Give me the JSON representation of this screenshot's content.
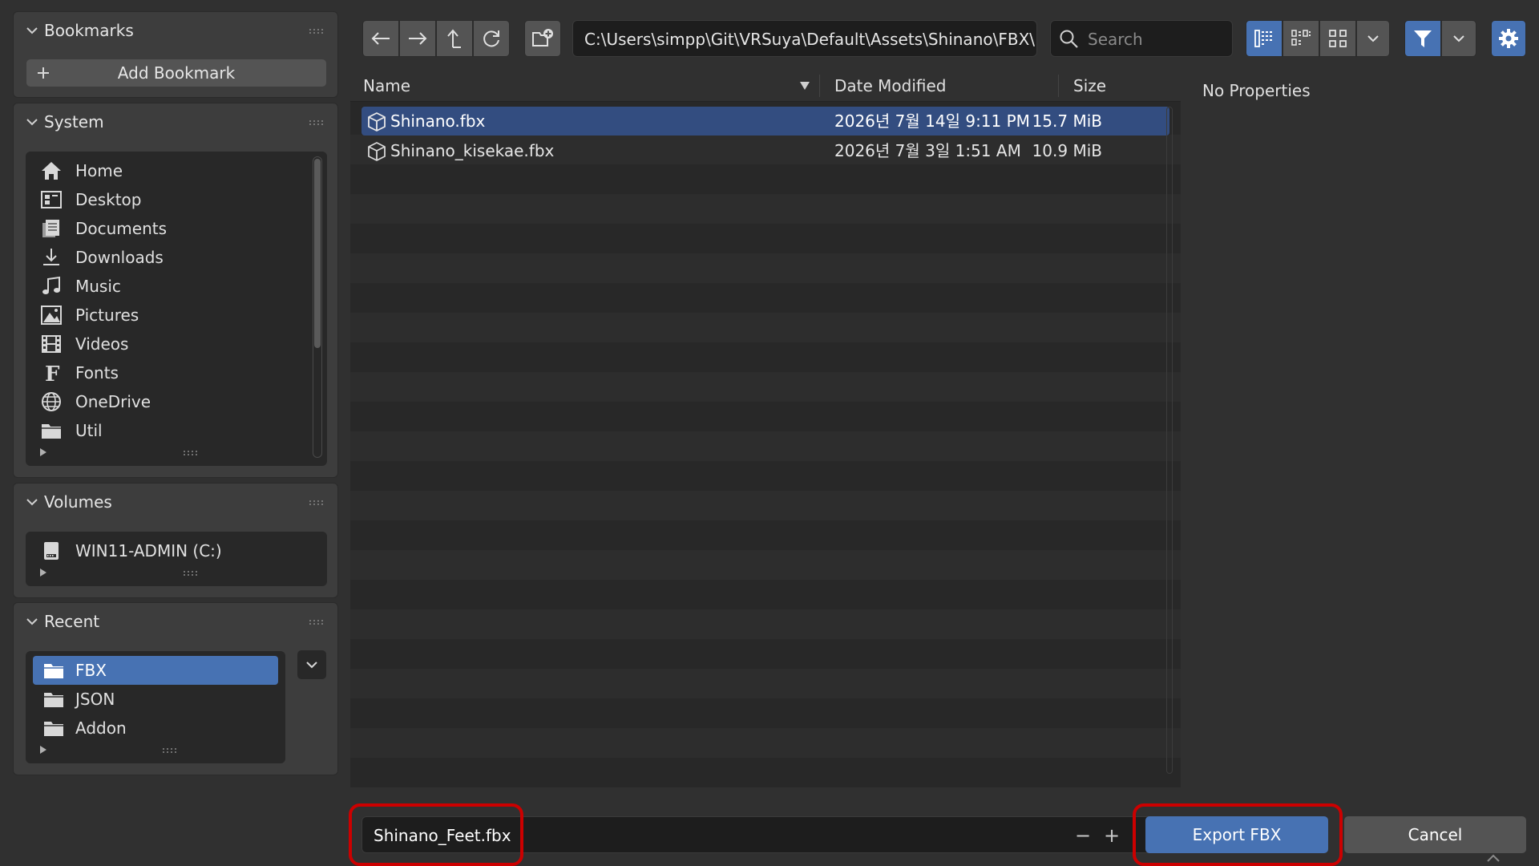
{
  "sidebar": {
    "bookmarks": {
      "title": "Bookmarks",
      "add_label": "Add Bookmark"
    },
    "system": {
      "title": "System",
      "items": [
        {
          "label": "Home",
          "icon": "home-icon"
        },
        {
          "label": "Desktop",
          "icon": "desktop-icon"
        },
        {
          "label": "Documents",
          "icon": "documents-icon"
        },
        {
          "label": "Downloads",
          "icon": "downloads-icon"
        },
        {
          "label": "Music",
          "icon": "music-icon"
        },
        {
          "label": "Pictures",
          "icon": "pictures-icon"
        },
        {
          "label": "Videos",
          "icon": "videos-icon"
        },
        {
          "label": "Fonts",
          "icon": "fonts-icon"
        },
        {
          "label": "OneDrive",
          "icon": "globe-icon"
        },
        {
          "label": "Util",
          "icon": "folder-icon"
        }
      ]
    },
    "volumes": {
      "title": "Volumes",
      "items": [
        {
          "label": "WIN11-ADMIN (C:)",
          "icon": "drive-icon"
        }
      ]
    },
    "recent": {
      "title": "Recent",
      "items": [
        {
          "label": "FBX",
          "icon": "folder-icon",
          "selected": true
        },
        {
          "label": "JSON",
          "icon": "folder-icon"
        },
        {
          "label": "Addon",
          "icon": "folder-icon"
        }
      ]
    }
  },
  "toolbar": {
    "path": "C:\\Users\\simpp\\Git\\VRSuya\\Default\\Assets\\Shinano\\FBX\\",
    "search_placeholder": "Search"
  },
  "file_list": {
    "columns": {
      "name": "Name",
      "date": "Date Modified",
      "size": "Size"
    },
    "files": [
      {
        "name": "Shinano.fbx",
        "date": "2026년 7월 14일 9:11 PM",
        "size": "15.7 MiB",
        "selected": true
      },
      {
        "name": "Shinano_kisekae.fbx",
        "date": "2026년 7월 3일 1:51 AM",
        "size": "10.9 MiB",
        "selected": false
      }
    ]
  },
  "properties": {
    "text": "No Properties"
  },
  "bottom": {
    "filename": "Shinano_Feet.fbx",
    "decrement": "−",
    "increment": "+",
    "export_label": "Export FBX",
    "cancel_label": "Cancel"
  },
  "colors": {
    "accent": "#4772b3",
    "highlight_outline": "#cc0000",
    "selected_row": "#334d80"
  }
}
